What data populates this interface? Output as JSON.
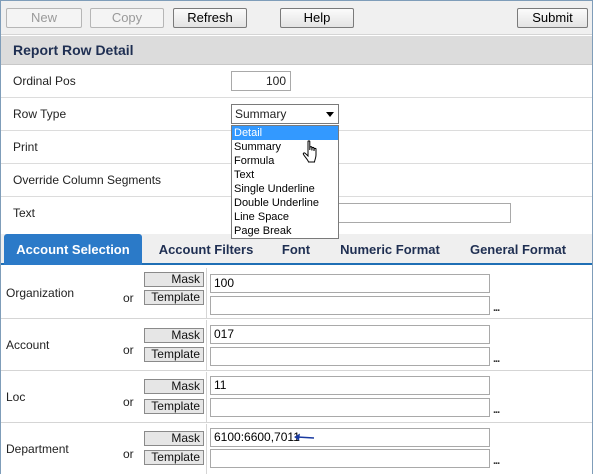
{
  "toolbar": {
    "new_label": "New",
    "copy_label": "Copy",
    "refresh_label": "Refresh",
    "help_label": "Help",
    "submit_label": "Submit"
  },
  "section": {
    "title": "Report Row Detail"
  },
  "detail": {
    "ordinal_pos_label": "Ordinal Pos",
    "ordinal_pos_value": "100",
    "row_type_label": "Row Type",
    "row_type_value": "Summary",
    "print_label": "Print",
    "override_label": "Override Column Segments",
    "text_label": "Text",
    "text_value": ""
  },
  "row_type_dropdown": {
    "options": [
      "Detail",
      "Summary",
      "Formula",
      "Text",
      "Single Underline",
      "Double Underline",
      "Line Space",
      "Page Break"
    ],
    "highlighted": "Detail"
  },
  "tabs": [
    {
      "label": "Account Selection",
      "active": true
    },
    {
      "label": "Account Filters",
      "active": false
    },
    {
      "label": "Font",
      "active": false
    },
    {
      "label": "Numeric Format",
      "active": false
    },
    {
      "label": "General Format",
      "active": false
    }
  ],
  "account_selection": {
    "mask_label": "Mask",
    "template_label": "Template",
    "or_label": "or",
    "ellipsis": "...",
    "rows": [
      {
        "label": "Organization",
        "mask": "100",
        "template": ""
      },
      {
        "label": "Account",
        "mask": "017",
        "template": ""
      },
      {
        "label": "Loc",
        "mask": "11",
        "template": ""
      },
      {
        "label": "Department",
        "mask": "6100:6600,7011",
        "template": ""
      }
    ]
  },
  "colors": {
    "header_text": "#1f2f52",
    "tab_active_bg": "#2b7ac8",
    "dropdown_highlight": "#3399ff",
    "annotation_arrow": "#1a3aa0"
  }
}
